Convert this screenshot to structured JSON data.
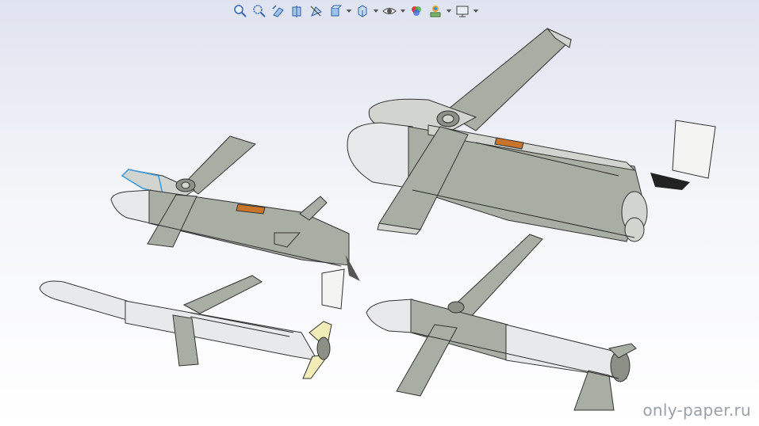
{
  "watermark": "only-paper.ru",
  "toolbar": {
    "buttons": [
      {
        "name": "zoom-to-fit-icon"
      },
      {
        "name": "zoom-to-area-icon"
      },
      {
        "name": "previous-view-icon"
      },
      {
        "name": "section-view-icon"
      },
      {
        "name": "dynamic-annotation-icon"
      },
      {
        "name": "view-orientation-icon",
        "dropdown": true
      },
      {
        "name": "display-style-icon",
        "dropdown": true
      },
      {
        "name": "hide-show-items-icon",
        "dropdown": true
      },
      {
        "name": "edit-appearance-icon"
      },
      {
        "name": "apply-scene-icon",
        "dropdown": true
      },
      {
        "name": "view-settings-icon",
        "dropdown": true
      }
    ]
  },
  "colors": {
    "body": "#a9aea4",
    "accent_orange": "#c8752a",
    "fin_yellow": "#f2ecb8",
    "seeker_blue": "#3a9be0"
  }
}
